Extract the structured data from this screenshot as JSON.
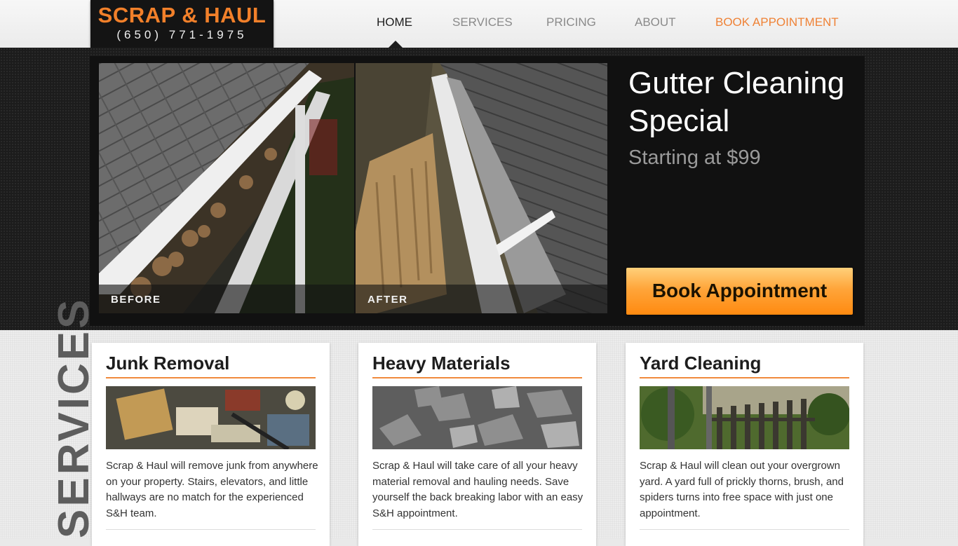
{
  "brand": {
    "name": "SCRAP & HAUL",
    "phone": "(650) 771-1975",
    "accent_color": "#f2802a"
  },
  "nav": {
    "items": [
      {
        "label": "HOME",
        "active": true
      },
      {
        "label": "SERVICES"
      },
      {
        "label": "PRICING"
      },
      {
        "label": "ABOUT"
      },
      {
        "label": "BOOK APPOINTMENT",
        "highlight": true
      }
    ]
  },
  "hero": {
    "before_caption": "BEFORE",
    "after_caption": "AFTER",
    "title": "Gutter Cleaning Special",
    "subtitle": "Starting at $99",
    "button_label": "Book Appointment"
  },
  "services": {
    "section_label": "SERVICES",
    "cards": [
      {
        "title": "Junk Removal",
        "text": "Scrap & Haul will remove junk from anywhere on your property. Stairs, elevators, and little hallways are no match for the experienced S&H team."
      },
      {
        "title": "Heavy Materials",
        "text": "Scrap & Haul will take care of all your heavy material removal and hauling needs. Save yourself the back breaking labor with an easy S&H appointment."
      },
      {
        "title": "Yard Cleaning",
        "text": "Scrap & Haul will clean out your overgrown yard. A yard full of prickly thorns, brush, and spiders turns into free space with just one appointment."
      }
    ]
  }
}
